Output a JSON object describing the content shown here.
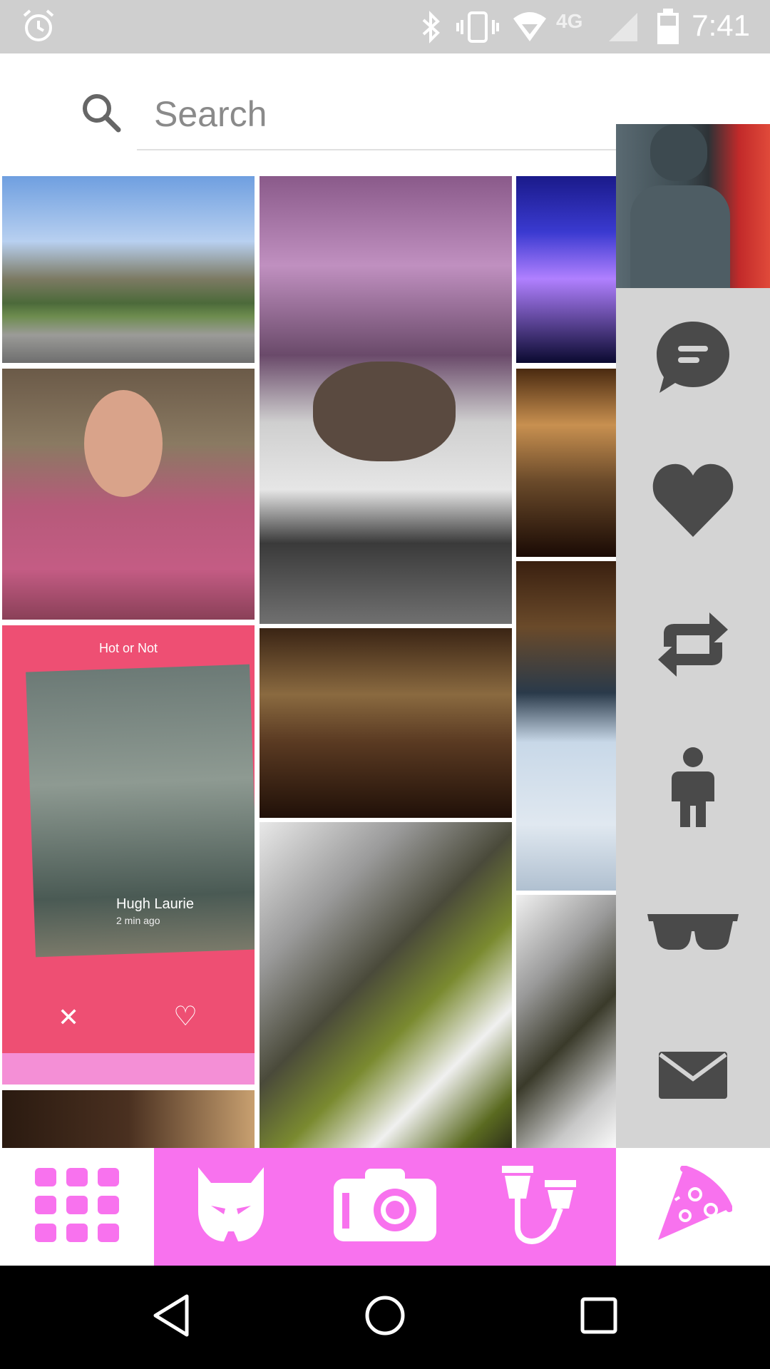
{
  "status_bar": {
    "time": "7:41",
    "icons": [
      "alarm-icon",
      "bluetooth-icon",
      "vibrate-icon",
      "wifi-icon",
      "network-4g-lte-icon",
      "signal-icon",
      "battery-icon"
    ]
  },
  "search": {
    "placeholder": "Search",
    "icon": "search-icon"
  },
  "grid": {
    "tiles": [
      {
        "name": "photo-park-pond",
        "description": "park"
      },
      {
        "name": "photo-dog-bed",
        "description": "dog"
      },
      {
        "name": "photo-concert",
        "description": "concert"
      },
      {
        "name": "photo-person-pink-coat",
        "description": "person"
      },
      {
        "name": "photo-dining-room",
        "description": "room"
      },
      {
        "name": "photo-hot-or-not-app",
        "description": "app"
      },
      {
        "name": "photo-room-high-view",
        "description": "room"
      },
      {
        "name": "photo-laptop-screen",
        "description": "screen"
      },
      {
        "name": "photo-waterfall",
        "description": "waterfall"
      },
      {
        "name": "photo-waterfall-2",
        "description": "waterfall"
      },
      {
        "name": "photo-dark-bottom",
        "description": "dark"
      }
    ],
    "app_screenshot": {
      "header": "Hot or Not",
      "person_name": "Hugh Laurie",
      "timestamp": "2 min ago"
    }
  },
  "sidebar": {
    "avatar": "robot-avatar",
    "buttons": [
      {
        "name": "chat-icon"
      },
      {
        "name": "heart-icon"
      },
      {
        "name": "repeat-icon"
      },
      {
        "name": "person-icon"
      },
      {
        "name": "sunglasses-icon"
      },
      {
        "name": "mail-icon"
      }
    ]
  },
  "bottom_nav": {
    "items": [
      "grid-icon",
      "mask-icon",
      "camera-icon",
      "connector-icon",
      "pizza-icon"
    ],
    "accent": "#f872ee",
    "highlight_range": "mask to connector"
  },
  "system_nav": {
    "items": [
      "back-icon",
      "home-icon",
      "recents-icon"
    ]
  }
}
